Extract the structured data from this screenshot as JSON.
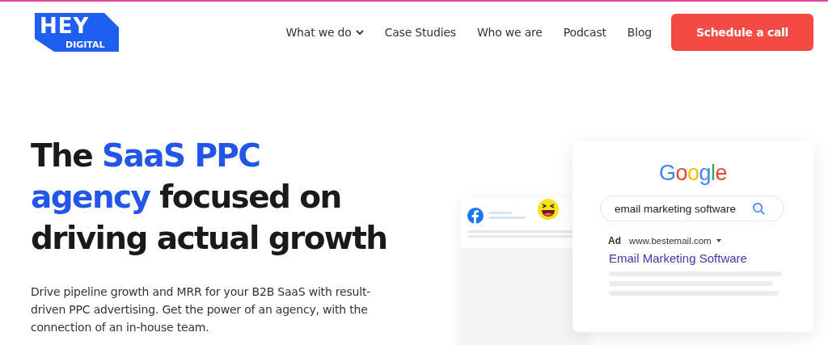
{
  "logo": {
    "top": "HEY",
    "bottom": "DIGITAL"
  },
  "nav": [
    {
      "label": "What we do",
      "dropdown": true
    },
    {
      "label": "Case Studies",
      "dropdown": false
    },
    {
      "label": "Who we are",
      "dropdown": false
    },
    {
      "label": "Podcast",
      "dropdown": false
    },
    {
      "label": "Blog",
      "dropdown": false
    }
  ],
  "cta": "Schedule a call",
  "headline": [
    {
      "text": "The ",
      "highlight": false
    },
    {
      "text": "SaaS PPC agency",
      "highlight": true
    },
    {
      "text": " focused on driving actual growth",
      "highlight": false
    }
  ],
  "intro": "Drive pipeline growth and MRR for your B2B SaaS with result-driven PPC advertising. Get the power of an agency, with the connection of an in-house team.",
  "search_card": {
    "brand": "Google",
    "query": "email marketing software",
    "ad_label": "Ad",
    "ad_url": "www.bestemail.com",
    "ad_title": "Email Marketing Software"
  }
}
